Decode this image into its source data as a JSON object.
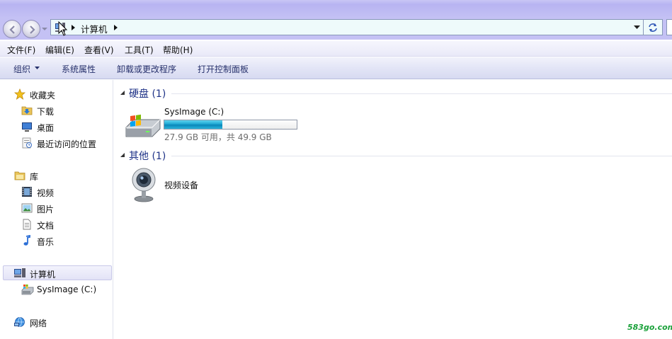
{
  "address": {
    "crumbs": [
      "计算机"
    ]
  },
  "menu": [
    "文件(F)",
    "编辑(E)",
    "查看(V)",
    "工具(T)",
    "帮助(H)"
  ],
  "commands": {
    "organize": "组织",
    "system_properties": "系统属性",
    "uninstall": "卸载或更改程序",
    "control_panel": "打开控制面板"
  },
  "nav": {
    "favorites": {
      "label": "收藏夹",
      "items": [
        "下载",
        "桌面",
        "最近访问的位置"
      ]
    },
    "libraries": {
      "label": "库",
      "items": [
        "视频",
        "图片",
        "文档",
        "音乐"
      ]
    },
    "computer": {
      "label": "计算机",
      "items": [
        "SysImage (C:)"
      ]
    },
    "network": {
      "label": "网络"
    }
  },
  "groups": {
    "hdd": {
      "title": "硬盘 (1)"
    },
    "other": {
      "title": "其他 (1)"
    }
  },
  "drive": {
    "name": "SysImage (C:)",
    "free_text": "27.9 GB 可用，共 49.9 GB",
    "free_gb": 27.9,
    "total_gb": 49.9,
    "used_fraction": 0.44
  },
  "device": {
    "name": "视频设备"
  },
  "watermark": "583go.com",
  "colors": {
    "accent": "#1e3287",
    "selection": "#e3e3f6",
    "drive_fill": "#1ea6d2"
  }
}
